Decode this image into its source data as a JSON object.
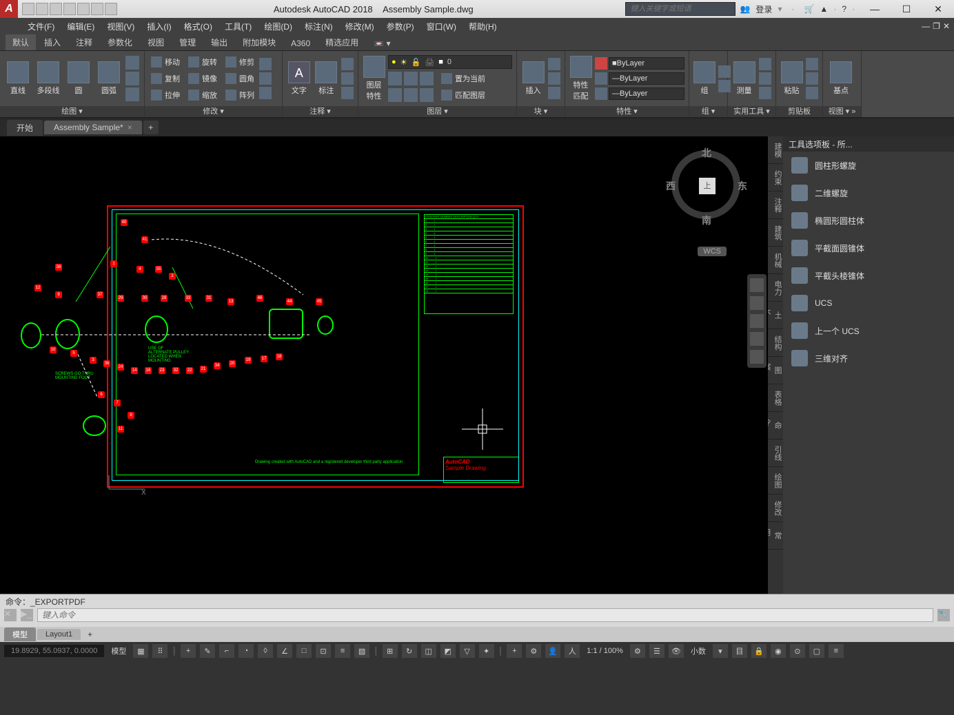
{
  "app": {
    "title": "Autodesk AutoCAD 2018",
    "filename": "Assembly Sample.dwg",
    "search_placeholder": "键入关键字或短语",
    "login": "登录"
  },
  "menu": [
    "文件(F)",
    "编辑(E)",
    "视图(V)",
    "插入(I)",
    "格式(O)",
    "工具(T)",
    "绘图(D)",
    "标注(N)",
    "修改(M)",
    "参数(P)",
    "窗口(W)",
    "帮助(H)"
  ],
  "ribbon_tabs": [
    "默认",
    "插入",
    "注释",
    "参数化",
    "视图",
    "管理",
    "输出",
    "附加模块",
    "A360",
    "精选应用"
  ],
  "panels": {
    "draw": {
      "title": "绘图 ▾",
      "items": [
        "直线",
        "多段线",
        "圆",
        "圆弧"
      ]
    },
    "modify": {
      "title": "修改 ▾",
      "rows": [
        [
          "移动",
          "旋转",
          "修剪"
        ],
        [
          "复制",
          "镜像",
          "圆角"
        ],
        [
          "拉伸",
          "缩放",
          "阵列"
        ]
      ]
    },
    "annot": {
      "title": "注释 ▾",
      "items": [
        "文字",
        "标注"
      ]
    },
    "layer": {
      "title": "图层 ▾",
      "btn": "图层\n特性",
      "current": "0",
      "set_current": "置为当前",
      "match": "匹配图层"
    },
    "block": {
      "title": "块 ▾",
      "btn": "插入"
    },
    "props": {
      "title": "特性 ▾",
      "btn": "特性\n匹配",
      "v1": "ByLayer",
      "v2": "ByLayer",
      "v3": "ByLayer"
    },
    "group": {
      "title": "组 ▾",
      "btn": "组"
    },
    "util": {
      "title": "实用工具 ▾",
      "btn": "测量"
    },
    "clip": {
      "title": "剪贴板",
      "btn": "粘贴"
    },
    "view": {
      "title": "视图 ▾ »",
      "btn": "基点"
    }
  },
  "filetabs": {
    "start": "开始",
    "active": "Assembly Sample*"
  },
  "viewcube": {
    "n": "北",
    "s": "南",
    "e": "东",
    "w": "西",
    "face": "上",
    "wcs": "WCS"
  },
  "tool_palette": {
    "title": "工具选项板 - 所...",
    "items": [
      "圆柱形螺旋",
      "二维螺旋",
      "椭圆形圆柱体",
      "平截面圆锥体",
      "平截头棱锥体",
      "UCS",
      "上一个 UCS",
      "三维对齐"
    ]
  },
  "side_tabs": [
    "建模",
    "约束",
    "注释",
    "建筑",
    "机械",
    "电力",
    "土木...",
    "结构",
    "图案...",
    "表格",
    "命令...",
    "引线",
    "绘图",
    "修改",
    "常用..."
  ],
  "drawing": {
    "credit": "Drawing created with AutoCAD and a registered developer third party application",
    "titleblock": "AutoCAD",
    "titleblock2": "Sample Drawing",
    "note1": "SCREWS GO THRU\nMOUNTING FOOT",
    "note2": "USE OF\nALTERNATE PULLEY\nLOCATED WHEN\nMOUNTING"
  },
  "cmd": {
    "history": "命令：_EXPORTPDF",
    "placeholder": "键入命令"
  },
  "layouts": {
    "model": "模型",
    "l1": "Layout1"
  },
  "status": {
    "coords": "19.8929, 55.0937, 0.0000",
    "model": "模型",
    "zoom": "1:1 / 100%",
    "precision": "小数"
  }
}
